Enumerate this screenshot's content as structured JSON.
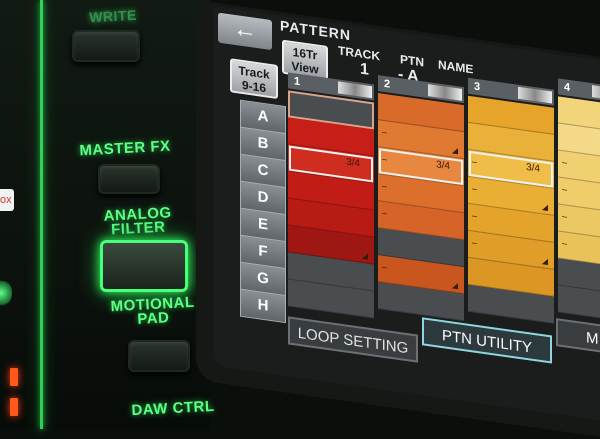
{
  "hardware": {
    "write_label": "WRITE",
    "master_fx_label": "MASTER FX",
    "analog_filter_label": "ANALOG\nFILTER",
    "motional_pad_label": "MOTIONAL\nPAD",
    "daw_ctrl_label": "DAW CTRL",
    "tooltip_text": "ox"
  },
  "screen": {
    "back_icon": "arrow-left-icon",
    "title": "PATTERN",
    "view_button": "16Tr\nView",
    "track_header": "TRACK",
    "track_value": "1",
    "ptn_header": "PTN",
    "ptn_value": "- A",
    "name_header": "NAME",
    "track_range_button": "Track\n9-16",
    "rows": [
      "A",
      "B",
      "C",
      "D",
      "E",
      "F",
      "G",
      "H"
    ],
    "columns": [
      {
        "number": "1",
        "color": "#c2201a"
      },
      {
        "number": "2",
        "color": "#d95a1c"
      },
      {
        "number": "3",
        "color": "#e9a52a"
      },
      {
        "number": "4",
        "color": "#f0cf6a"
      }
    ],
    "dash": "–",
    "triangle": "◢",
    "fraction": "3/4",
    "bottom_buttons": {
      "loop_setting": "LOOP SETTING",
      "ptn_utility": "PTN UTILITY",
      "more": "M"
    }
  }
}
